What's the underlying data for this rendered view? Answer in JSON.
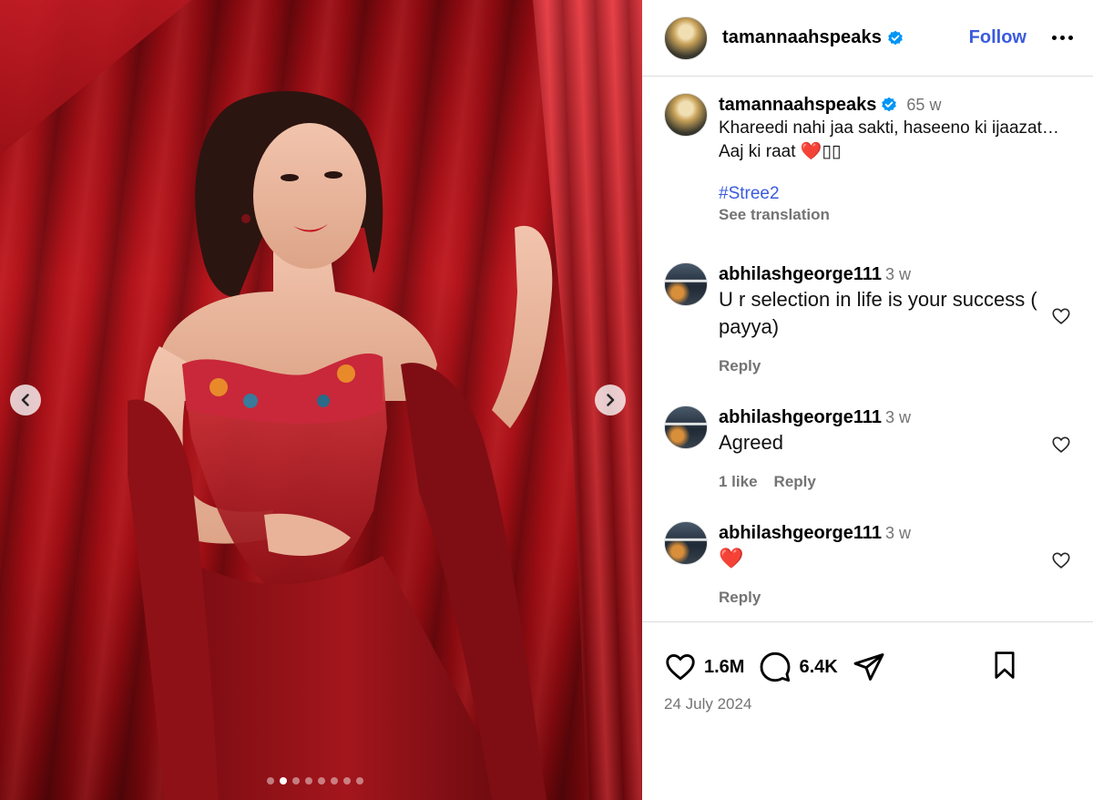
{
  "post": {
    "carousel": {
      "total_slides": 8,
      "active_index": 1
    },
    "header": {
      "username": "tamannaahspeaks",
      "follow_label": "Follow"
    },
    "caption": {
      "username": "tamannaahspeaks",
      "time": "65 w",
      "text": "Khareedi nahi jaa sakti, haseeno ki ijaazat… Aaj ki raat ❤️▯▯",
      "hashtag": "#Stree2",
      "see_translation": "See translation"
    },
    "comments": [
      {
        "username": "abhilashgeorge111",
        "time": "3 w",
        "text": "U r selection in life is your success ( payya)",
        "likes": "",
        "reply": "Reply"
      },
      {
        "username": "abhilashgeorge111",
        "time": "3 w",
        "text": "Agreed",
        "likes": "1 like",
        "reply": "Reply"
      },
      {
        "username": "abhilashgeorge111",
        "time": "3 w",
        "text": "❤️",
        "likes": "",
        "reply": "Reply"
      }
    ],
    "stats": {
      "likes": "1.6M",
      "comments": "6.4K"
    },
    "date": "24 July 2024",
    "colors": {
      "accent_blue": "#3a5bde",
      "verified_blue": "#0095f6",
      "muted": "#737373",
      "heart_red": "#e8232f"
    }
  }
}
